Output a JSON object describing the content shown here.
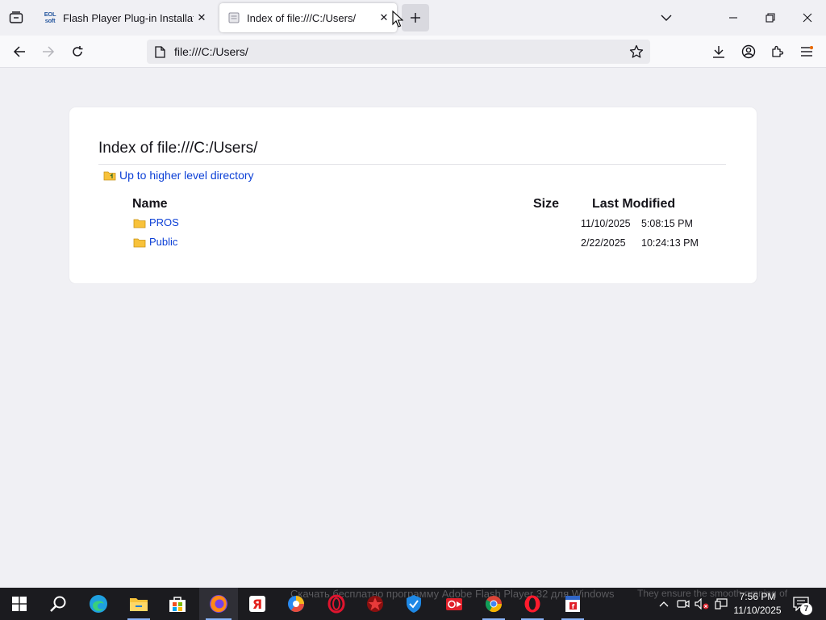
{
  "browser": {
    "tabs": [
      {
        "title": "Flash Player Plug-in Installation",
        "favicon": "eol-soft-icon",
        "active": false,
        "favicon_text": "EOL\nsoft"
      },
      {
        "title": "Index of file:///C:/Users/",
        "favicon": "page-icon",
        "active": true
      }
    ],
    "close_glyph": "✕",
    "address": "file:///C:/Users/"
  },
  "page": {
    "heading": "Index of file:///C:/Users/",
    "up_link": "Up to higher level directory",
    "columns": {
      "name": "Name",
      "size": "Size",
      "modified": "Last Modified"
    },
    "entries": [
      {
        "name": "PROS",
        "size": "",
        "date": "11/10/2025",
        "time": "5:08:15 PM"
      },
      {
        "name": "Public",
        "size": "",
        "date": "2/22/2025",
        "time": "10:24:13 PM"
      }
    ]
  },
  "taskbar": {
    "apps": [
      "windows-start",
      "search",
      "edge",
      "file-explorer",
      "microsoft-store",
      "firefox",
      "yandex",
      "browser",
      "opera-gx",
      "app-red",
      "security",
      "media",
      "chrome",
      "opera",
      "flash-app"
    ],
    "active_app": "firefox",
    "background_text": "Скачать бесплатно программу Adobe Flash Player 32 для Windows",
    "background_text_right": "They ensure the smooth running of",
    "clock": {
      "time": "7:56 PM",
      "date": "11/10/2025"
    },
    "notification_count": "7"
  },
  "colors": {
    "link": "#0b3fd6",
    "folder": "#f8c23a",
    "taskbar": "#1b1b1f"
  }
}
